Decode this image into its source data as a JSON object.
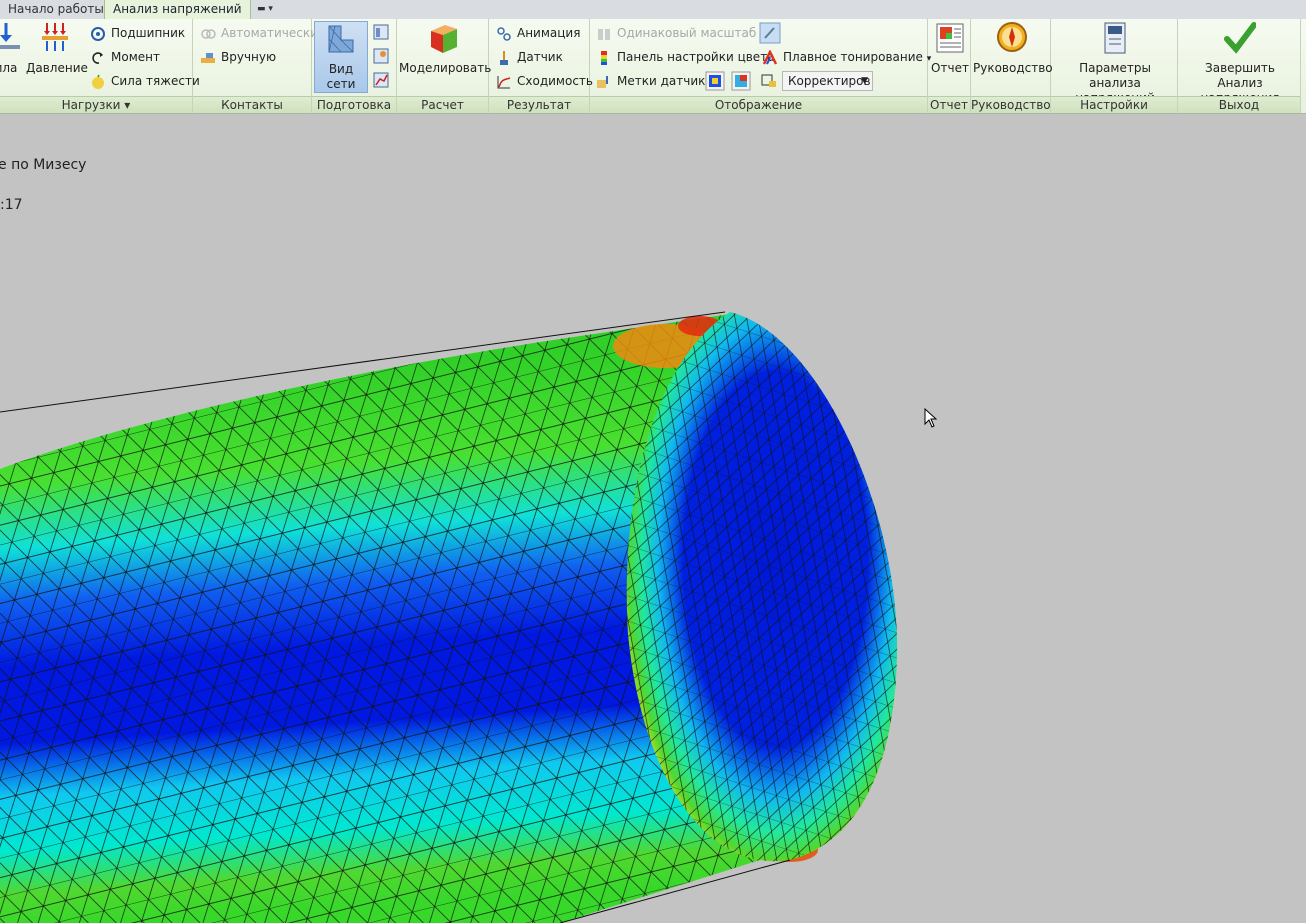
{
  "tabs": {
    "home": "Начало работы",
    "stress": "Анализ напряжений"
  },
  "groups": {
    "loads": {
      "label": "Нагрузки",
      "force": "ила",
      "pressure": "Давление",
      "bearing": "Подшипник",
      "moment": "Момент",
      "gravity": "Сила тяжести"
    },
    "contacts": {
      "label": "Контакты",
      "automatic": "Автоматически",
      "manual": "Вручную"
    },
    "prepare": {
      "label": "Подготовка",
      "mesh_view": "Вид сети"
    },
    "solve": {
      "label": "Расчет",
      "simulate": "Моделировать"
    },
    "result": {
      "label": "Результат",
      "animation": "Анимация",
      "probe": "Датчик",
      "convergence": "Сходимость"
    },
    "display": {
      "label": "Отображение",
      "same_scale": "Одинаковый масштаб",
      "color_bar": "Панель настройки цвета",
      "probe_labels": "Метки датчика",
      "smooth_shading": "Плавное тонирование",
      "adjust_combo": "Корректиров"
    },
    "report": {
      "label": "Отчет",
      "report": "Отчет"
    },
    "guide": {
      "label": "Руководство",
      "guide": "Руководство"
    },
    "settings": {
      "label": "Настройки",
      "params_line1": "Параметры",
      "params_line2": "анализа напряжений"
    },
    "exit": {
      "label": "Выход",
      "finish_line1": "Завершить",
      "finish_line2": "Анализ напряжения"
    }
  },
  "viewport": {
    "result_type": "е по Мизесу",
    "time_line": ":17"
  },
  "colors": {
    "blue": "#0018e0",
    "cyan": "#00e8f0",
    "green": "#38d82a",
    "yellow": "#f4e020",
    "orange": "#f07a10",
    "red": "#d82010"
  }
}
